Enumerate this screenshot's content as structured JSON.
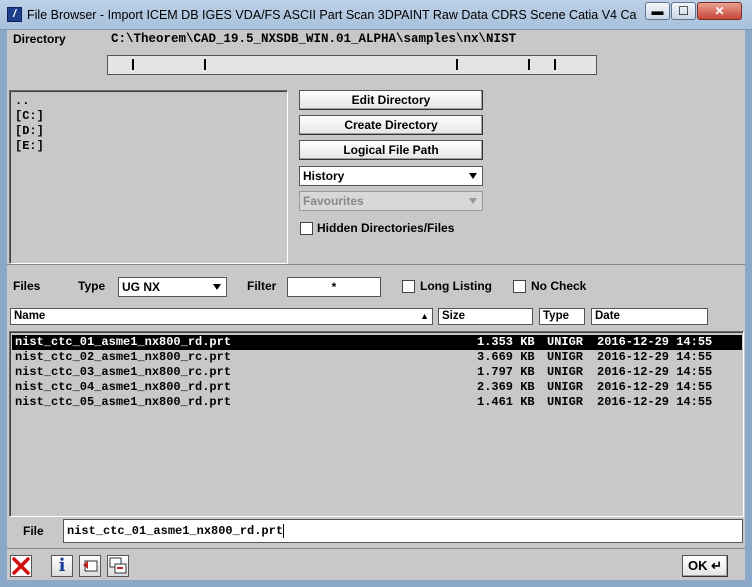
{
  "window": {
    "title": "File Browser - Import  ICEM DB  IGES  VDA/FS  ASCII Part  Scan  3DPAINT  Raw Data  CDRS Scene  Catia V4  Catia V5 ...",
    "minimize_glyph": "▬",
    "maximize_glyph": "☐",
    "close_glyph": "✕",
    "app_icon_glyph": "/"
  },
  "directory": {
    "label": "Directory",
    "path": "C:\\Theorem\\CAD_19.5_NXSDB_WIN.01_ALPHA\\samples\\nx\\NIST",
    "entries": [
      "..",
      "[C:]",
      "[D:]",
      "[E:]"
    ]
  },
  "actions": {
    "edit_directory": "Edit Directory",
    "create_directory": "Create Directory",
    "logical_file_path": "Logical File Path",
    "history": "History",
    "favourites": "Favourites",
    "hidden_label": "Hidden Directories/Files"
  },
  "files": {
    "label": "Files",
    "type_label": "Type",
    "type_value": "UG NX",
    "filter_label": "Filter",
    "filter_value": "*",
    "long_listing": "Long Listing",
    "no_check": "No Check",
    "columns": {
      "name": "Name",
      "size": "Size",
      "type": "Type",
      "date": "Date"
    },
    "rows": [
      {
        "name": "nist_ctc_01_asme1_nx800_rd.prt",
        "size": "1.353 KB",
        "type": "UNIGR",
        "date": "2016-12-29 14:55",
        "selected": true
      },
      {
        "name": "nist_ctc_02_asme1_nx800_rc.prt",
        "size": "3.669 KB",
        "type": "UNIGR",
        "date": "2016-12-29 14:55",
        "selected": false
      },
      {
        "name": "nist_ctc_03_asme1_nx800_rc.prt",
        "size": "1.797 KB",
        "type": "UNIGR",
        "date": "2016-12-29 14:55",
        "selected": false
      },
      {
        "name": "nist_ctc_04_asme1_nx800_rd.prt",
        "size": "2.369 KB",
        "type": "UNIGR",
        "date": "2016-12-29 14:55",
        "selected": false
      },
      {
        "name": "nist_ctc_05_asme1_nx800_rd.prt",
        "size": "1.461 KB",
        "type": "UNIGR",
        "date": "2016-12-29 14:55",
        "selected": false
      }
    ]
  },
  "file_field": {
    "label": "File",
    "value": "nist_ctc_01_asme1_nx800_rd.prt"
  },
  "bottom": {
    "ok_label": "OK",
    "ok_glyph": "↵",
    "cancel_icon": "red-x-icon",
    "info_icon": "info-icon",
    "undo_icon": "back-icon",
    "copy_icon": "copy-icon",
    "info_glyph": "i"
  },
  "colors": {
    "selection": "#000000",
    "panel": "#c8c8c8",
    "frame": "#8aa9c9",
    "cancel": "#d01010"
  }
}
